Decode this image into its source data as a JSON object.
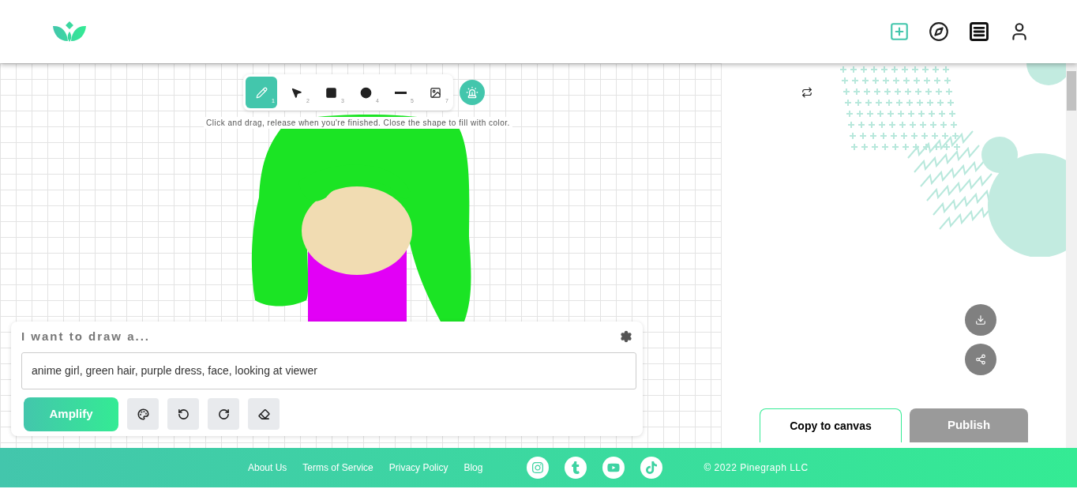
{
  "toolbar": {
    "tools": [
      {
        "kind": "pencil",
        "number": "1",
        "selected": true
      },
      {
        "kind": "pointer",
        "number": "2",
        "selected": false
      },
      {
        "kind": "square",
        "number": "3",
        "selected": false
      },
      {
        "kind": "circle",
        "number": "4",
        "selected": false
      },
      {
        "kind": "line",
        "number": "5",
        "selected": false
      },
      {
        "kind": "image",
        "number": "7",
        "selected": false
      }
    ],
    "hint": "Click and drag, release when you're finished. Close the shape to fill with color."
  },
  "prompt": {
    "title": "I want to draw a...",
    "value": "anime girl, green hair, purple dress, face, looking at viewer",
    "amplify": "Amplify"
  },
  "result": {
    "copy": "Copy to canvas",
    "publish": "Publish"
  },
  "footer": {
    "links": [
      "About Us",
      "Terms of Service",
      "Privacy Policy",
      "Blog"
    ],
    "copyright": "© 2022 Pinegraph LLC"
  }
}
